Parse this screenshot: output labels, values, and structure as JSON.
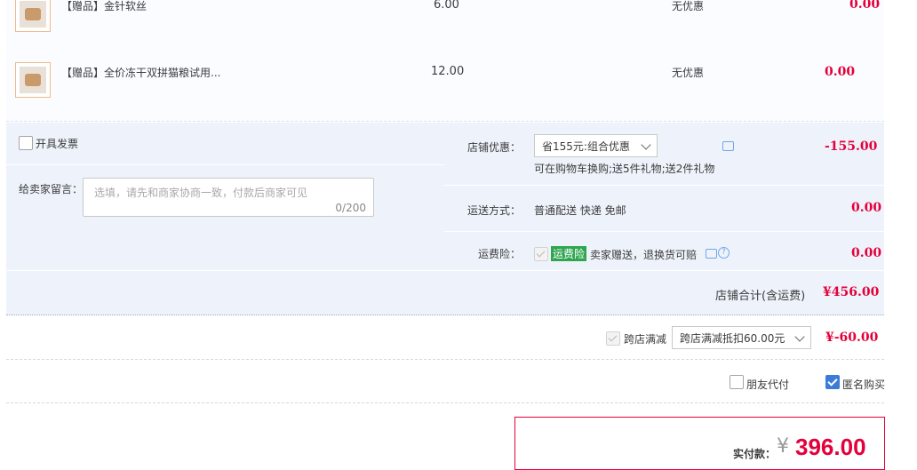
{
  "items": [
    {
      "name": "【赠品】金针软丝",
      "price": "6.00",
      "promo": "无优惠",
      "subtotal": "0.00"
    },
    {
      "name": "【赠品】全价冻干双拼猫粮试用...",
      "price": "12.00",
      "promo": "无优惠",
      "subtotal": "0.00"
    }
  ],
  "invoice": {
    "label": "开具发票"
  },
  "message": {
    "label": "给卖家留言：",
    "placeholder": "选填，请先和商家协商一致，付款后商家可见",
    "counter": "0/200"
  },
  "shop_discount": {
    "label": "店铺优惠：",
    "selected": "省155元:组合优惠",
    "note": "可在购物车换购;送5件礼物;送2件礼物",
    "amount": "-155.00"
  },
  "shipping": {
    "label": "运送方式：",
    "value": "普通配送 快递 免邮",
    "amount": "0.00"
  },
  "insurance": {
    "label": "运费险：",
    "tag": "运费险",
    "desc": "卖家赠送，退换货可赔",
    "amount": "0.00"
  },
  "shop_total": {
    "label": "店铺合计(含运费)",
    "amount": "¥456.00"
  },
  "cross_store": {
    "label": "跨店满减",
    "selected": "跨店满减抵扣60.00元",
    "amount": "¥-60.00"
  },
  "options": {
    "friend_pay": "朋友代付",
    "anonymous": "匿名购买"
  },
  "payment": {
    "label": "实付款：",
    "currency": "¥",
    "amount": "396.00"
  },
  "colors": {
    "accent": "#e4003a",
    "panel_bg": "#eef3fb",
    "check_blue": "#3d7bd9",
    "tag_green": "#2fa550"
  }
}
